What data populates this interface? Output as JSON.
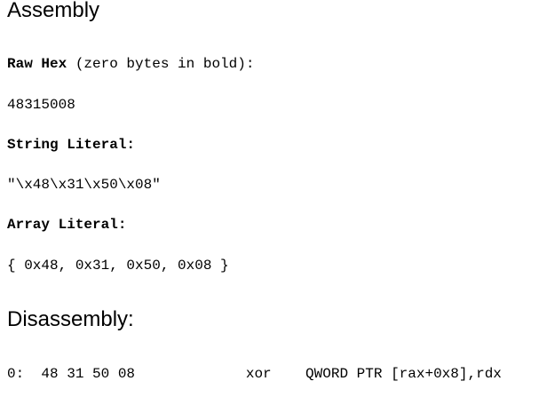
{
  "assembly_section": {
    "title": "Assembly",
    "raw_hex": {
      "label": "Raw Hex",
      "note": " (zero bytes in bold):",
      "value": "48315008"
    },
    "string_literal": {
      "label": "String Literal:",
      "value": "\"\\x48\\x31\\x50\\x08\""
    },
    "array_literal": {
      "label": "Array Literal:",
      "value": "{ 0x48, 0x31, 0x50, 0x08 }"
    }
  },
  "disassembly_section": {
    "title": "Disassembly:",
    "lines": [
      {
        "text": "0:  48 31 50 08             xor    QWORD PTR [rax+0x8],rdx"
      }
    ]
  }
}
